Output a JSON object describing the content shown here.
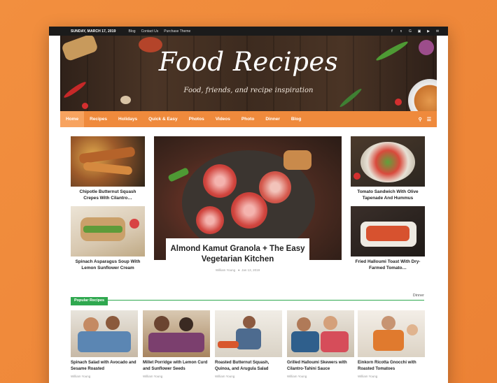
{
  "topbar": {
    "date": "SUNDAY, MARCH 17, 2019",
    "links": [
      "Blog",
      "Contact Us",
      "Purchase Theme"
    ],
    "social": [
      "f",
      "t",
      "G+",
      "ig",
      "yt",
      "envelope"
    ]
  },
  "header": {
    "logo": "Food Recipes",
    "tagline": "Food, friends, and recipe inspiration"
  },
  "nav": {
    "items": [
      "Home",
      "Recipes",
      "Holidays",
      "Quick & Easy",
      "Photos",
      "Videos",
      "Photo",
      "Dinner",
      "Blog"
    ],
    "active": "Home"
  },
  "left_cards": [
    {
      "title": "Chipotle Butternut Squash Crepes With Cilantro…"
    },
    {
      "title": "Spinach Asparagus Soup With Lemon Sunflower Cream"
    }
  ],
  "feature": {
    "title": "Almond Kamut Granola + The Easy Vegetarian Kitchen",
    "author": "William Young",
    "date": "Jan 13, 2019"
  },
  "right_cards": [
    {
      "title": "Tomato Sandwich With Olive Tapenade And Hummus"
    },
    {
      "title": "Fried Halloumi Toast With Dry-Farmed Tomato…"
    }
  ],
  "popular": {
    "heading": "Popular Recipes",
    "right_label": "Dinner",
    "items": [
      {
        "title": "Spinach Salad with Avocado and Sesame Roasted",
        "author": "William Young"
      },
      {
        "title": "Millet Porridge with Lemon Curd and Sunflower Seeds",
        "author": "William Young"
      },
      {
        "title": "Roasted Butternut Squash, Quinoa, and Arugula Salad",
        "author": "William Young"
      },
      {
        "title": "Grilled Halloumi Skewers with Cilantro-Tahini Sauce",
        "author": "William Young"
      },
      {
        "title": "Einkorn Ricotta Gnocchi with Roasted Tomatoes",
        "author": "William Young"
      }
    ]
  },
  "colors": {
    "accent": "#ef8a3c",
    "nav_active": "#f7a35f",
    "popular_green": "#2fa84f",
    "topbar": "#1b1b1b"
  }
}
